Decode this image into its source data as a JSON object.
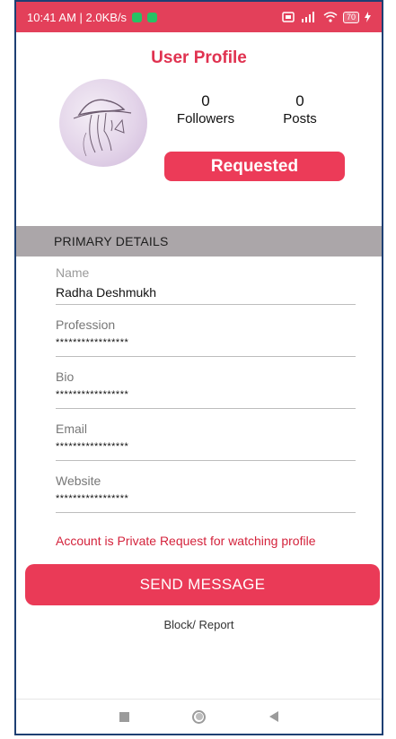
{
  "status_bar": {
    "time_speed": "10:41 AM | 2.0KB/s",
    "battery": "70"
  },
  "header": {
    "title": "User Profile"
  },
  "profile": {
    "followers_count": "0",
    "followers_label": "Followers",
    "posts_count": "0",
    "posts_label": "Posts",
    "request_button_label": "Requested"
  },
  "details": {
    "section_title": "PRIMARY DETAILS",
    "fields": [
      {
        "label": "Name",
        "value": "Radha Deshmukh"
      },
      {
        "label": "Profession",
        "value": "*****************"
      },
      {
        "label": "Bio",
        "value": "*****************"
      },
      {
        "label": "Email",
        "value": "*****************"
      },
      {
        "label": "Website",
        "value": "*****************"
      }
    ]
  },
  "notice": "Account is Private Request for watching profile",
  "actions": {
    "send_message_label": "SEND MESSAGE",
    "block_report_label": "Block/ Report"
  },
  "colors": {
    "accent": "#ea3a57",
    "section_header": "#aba6a9",
    "notice_text": "#d4233c"
  },
  "icons": {
    "nav": [
      "recent-apps-icon",
      "home-icon",
      "back-icon"
    ]
  }
}
